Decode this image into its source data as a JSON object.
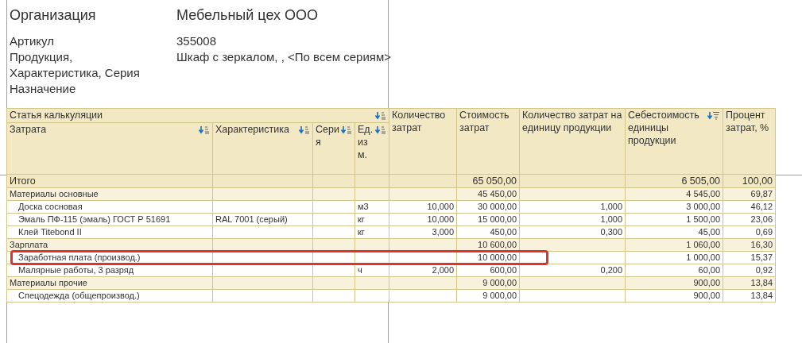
{
  "header": {
    "organization_label": "Организация",
    "organization": "Мебельный цех ООО",
    "fields": [
      {
        "label": "Артикул",
        "value": "355008"
      },
      {
        "label": "Продукция, Характеристика, Серия",
        "value": "Шкаф с зеркалом, , <По всем сериям>"
      },
      {
        "label": "Назначение"
      }
    ]
  },
  "table": {
    "group_header": {
      "label": "Статья калькуляции",
      "sortable": true,
      "sorted": false
    },
    "columns": [
      {
        "label": "Затрата",
        "sortable": true,
        "sorted": false
      },
      {
        "label": "Характеристика",
        "sortable": true,
        "sorted": false
      },
      {
        "label": "Серия",
        "sortable": true,
        "sorted": false
      },
      {
        "label": "Ед. изм.",
        "sortable": true,
        "sorted": false
      },
      {
        "label": "Количество затрат",
        "sortable": false,
        "sorted": false
      },
      {
        "label": "Стоимость затрат",
        "sortable": false,
        "sorted": false
      },
      {
        "label": "Количество затрат на единицу продукции",
        "sortable": false,
        "sorted": false
      },
      {
        "label": "Себестоимость единицы продукции",
        "sortable": true,
        "sorted": true
      },
      {
        "label": "Процент затрат, %",
        "sortable": false,
        "sorted": false
      }
    ],
    "rows": [
      {
        "kind": "total",
        "highlighted": false,
        "cells": [
          "Итого",
          "",
          "",
          "",
          "",
          "65 050,00",
          "",
          "6 505,00",
          "100,00"
        ]
      },
      {
        "kind": "group",
        "highlighted": false,
        "cells": [
          "Материалы основные",
          "",
          "",
          "",
          "",
          "45 450,00",
          "",
          "4 545,00",
          "69,87"
        ]
      },
      {
        "kind": "item",
        "highlighted": false,
        "cells": [
          "Доска сосновая",
          "",
          "",
          "м3",
          "10,000",
          "30 000,00",
          "1,000",
          "3 000,00",
          "46,12"
        ]
      },
      {
        "kind": "item",
        "highlighted": false,
        "cells": [
          "Эмаль ПФ-115 (эмаль) ГОСТ Р 51691",
          "RAL 7001 (серый)",
          "",
          "кг",
          "10,000",
          "15 000,00",
          "1,000",
          "1 500,00",
          "23,06"
        ]
      },
      {
        "kind": "item",
        "highlighted": false,
        "cells": [
          "Клей Titebond II",
          "",
          "",
          "кг",
          "3,000",
          "450,00",
          "0,300",
          "45,00",
          "0,69"
        ]
      },
      {
        "kind": "group",
        "highlighted": false,
        "cells": [
          "Зарплата",
          "",
          "",
          "",
          "",
          "10 600,00",
          "",
          "1 060,00",
          "16,30"
        ]
      },
      {
        "kind": "item",
        "highlighted": true,
        "cells": [
          "Заработная плата (производ.)",
          "",
          "",
          "",
          "",
          "10 000,00",
          "",
          "1 000,00",
          "15,37"
        ]
      },
      {
        "kind": "item",
        "highlighted": false,
        "cells": [
          "Малярные работы, 3 разряд",
          "",
          "",
          "ч",
          "2,000",
          "600,00",
          "0,200",
          "60,00",
          "0,92"
        ]
      },
      {
        "kind": "group",
        "highlighted": false,
        "cells": [
          "Материалы прочие",
          "",
          "",
          "",
          "",
          "9 000,00",
          "",
          "900,00",
          "13,84"
        ]
      },
      {
        "kind": "item",
        "highlighted": false,
        "cells": [
          "Спецодежда (общепроизвод.)",
          "",
          "",
          "",
          "",
          "9 000,00",
          "",
          "900,00",
          "13,84"
        ]
      }
    ]
  }
}
